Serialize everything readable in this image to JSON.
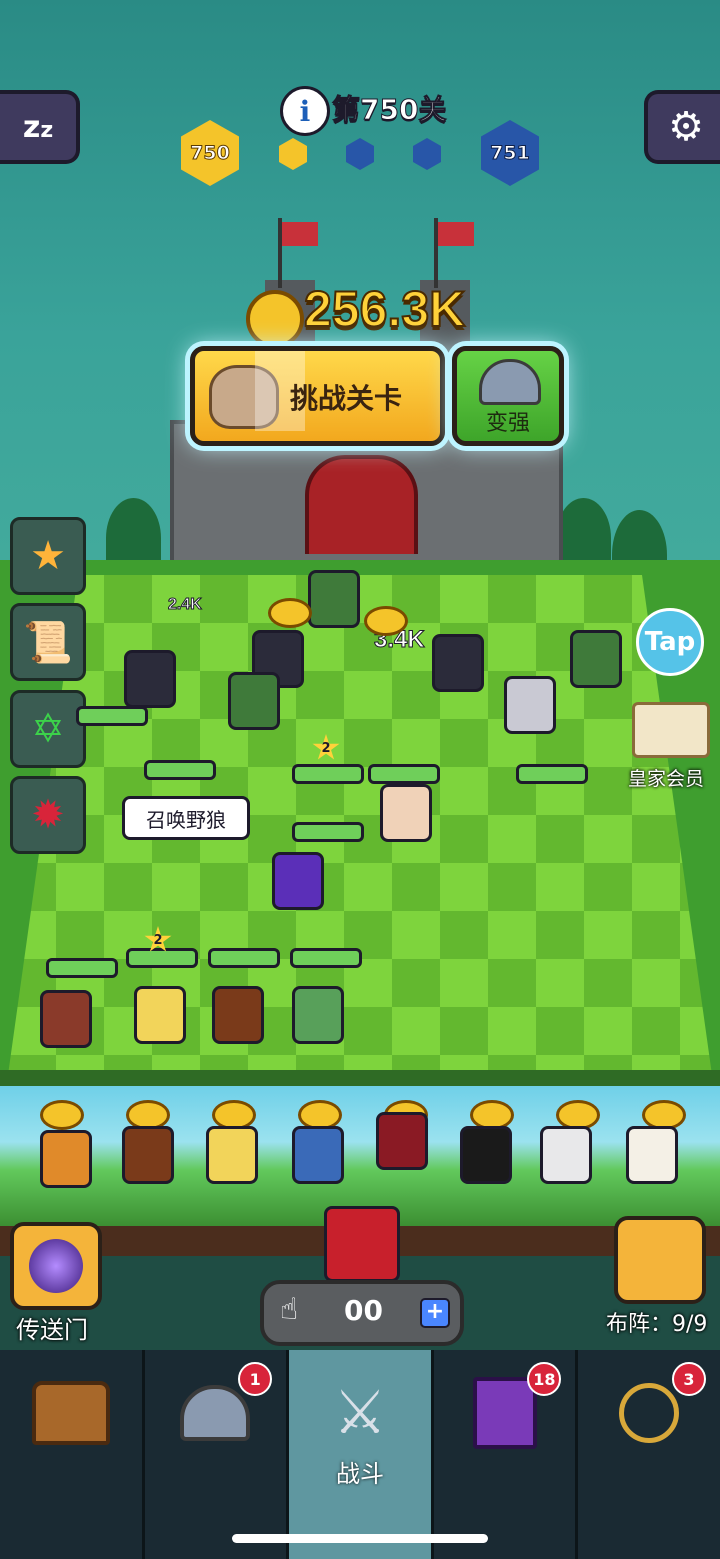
{
  "top": {
    "sleep_icon": "zzz-icon",
    "settings_icon": "gear-icon",
    "info_icon": "i",
    "level_title": "第750关",
    "current_level": "750",
    "next_level": "751"
  },
  "battle": {
    "gold_total": "256.3K",
    "challenge_label": "挑战关卡",
    "upgrade_label": "变强",
    "damage_values": [
      "2.4K",
      "3.4K"
    ],
    "summon_label": "召唤野狼",
    "star_levels": [
      "2",
      "2"
    ],
    "tap_label": "Tap",
    "vip_label": "皇家会员"
  },
  "bench": {
    "portal_label": "传送门",
    "formation_label": "布阵：9/9",
    "counter_value": "00",
    "counter_plus": "+"
  },
  "nav": {
    "items": [
      {
        "name": "chest",
        "icon": "treasure-chest-icon",
        "badge": "",
        "label": ""
      },
      {
        "name": "heroes",
        "icon": "viking-helmet-icon",
        "badge": "1",
        "label": ""
      },
      {
        "name": "battle",
        "icon": "crossed-swords-icon",
        "badge": "",
        "label": "战斗"
      },
      {
        "name": "codex",
        "icon": "spellbook-icon",
        "badge": "18",
        "label": ""
      },
      {
        "name": "necklace",
        "icon": "amulet-icon",
        "badge": "3",
        "label": ""
      }
    ]
  },
  "colors": {
    "gold": "#f4c42a",
    "level_blue": "#2856a8",
    "board_light": "#7ed43d",
    "board_dark": "#63b82f",
    "badge_red": "#d8243a"
  }
}
